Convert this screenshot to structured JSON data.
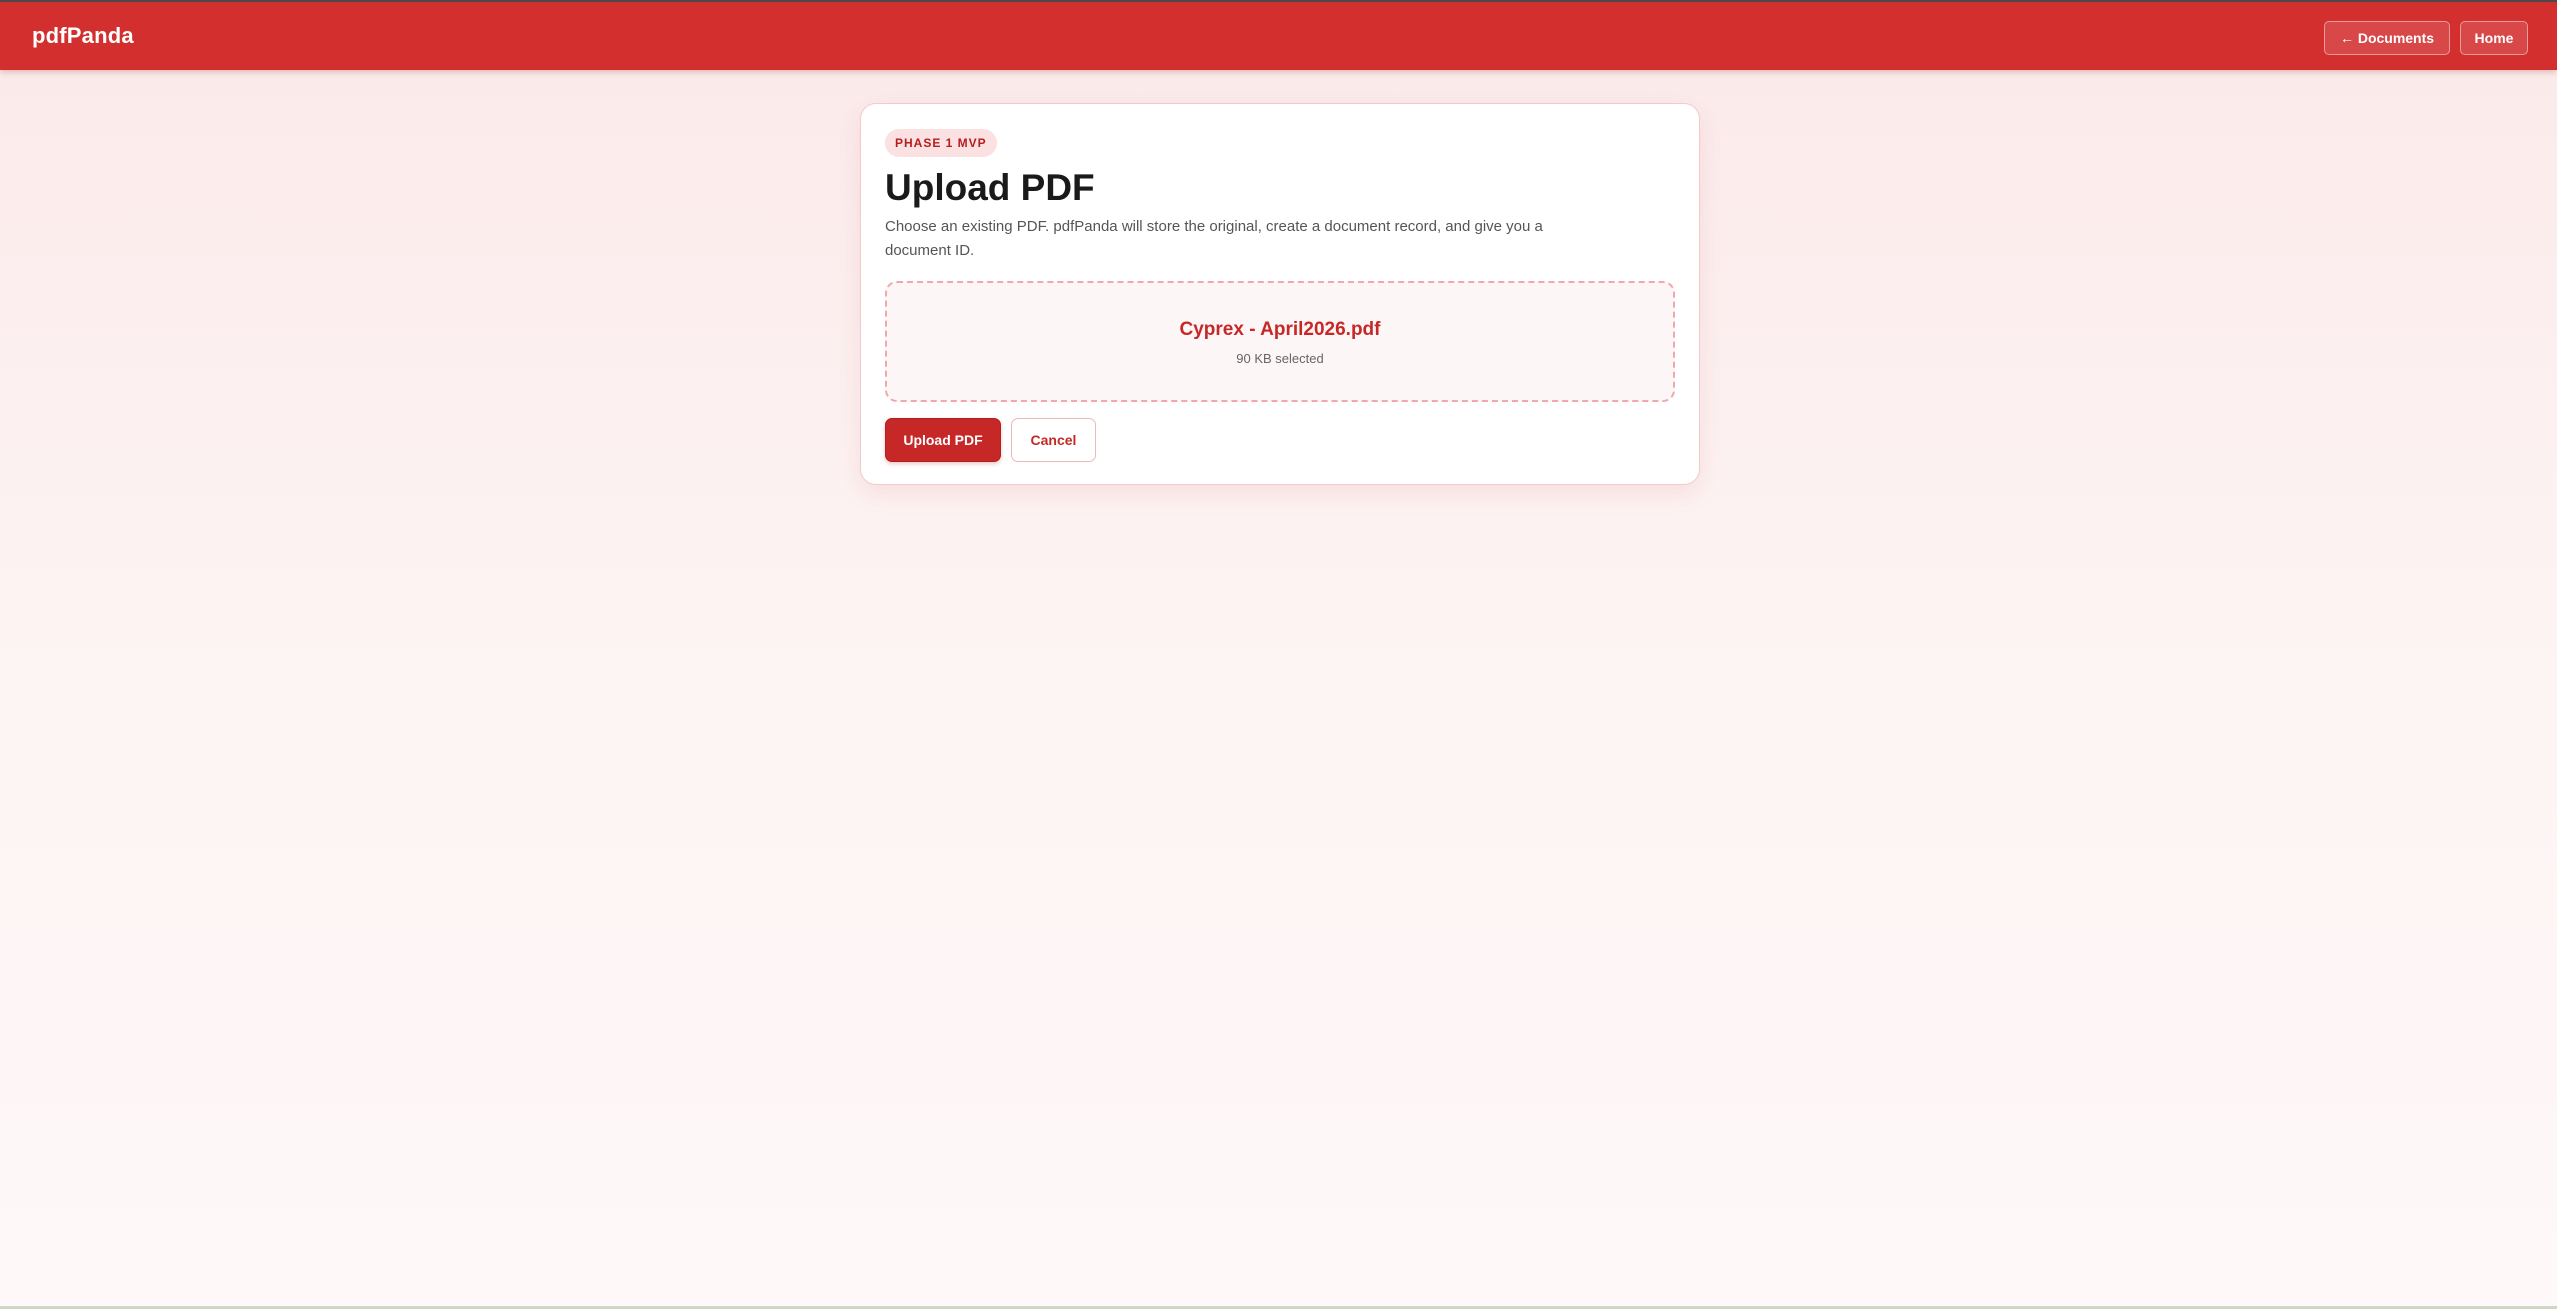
{
  "app": {
    "brand": "pdfPanda"
  },
  "nav": {
    "documents_label": "← Documents",
    "home_label": "Home"
  },
  "card": {
    "badge": "PHASE 1 MVP",
    "title": "Upload PDF",
    "description": "Choose an existing PDF. pdfPanda will store the original, create a document record, and give you a document ID."
  },
  "dropzone": {
    "filename": "Cyprex - April2026.pdf",
    "filesize": "90 KB selected"
  },
  "actions": {
    "upload_label": "Upload PDF",
    "cancel_label": "Cancel"
  },
  "colors": {
    "brand_red": "#d32f2f",
    "accent_dark_red": "#c62828",
    "badge_bg": "#fbe1e1",
    "dropzone_border": "#f1a7ad"
  }
}
